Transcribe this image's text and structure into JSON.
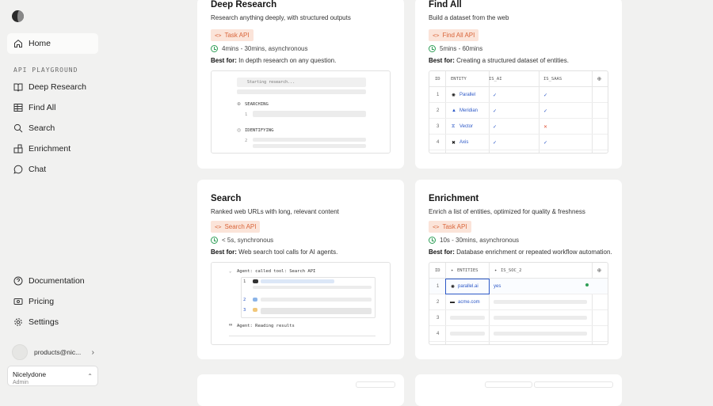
{
  "sidebar": {
    "home": "Home",
    "section_label": "API PLAYGROUND",
    "items": [
      {
        "label": "Deep Research",
        "icon": "book-icon"
      },
      {
        "label": "Find All",
        "icon": "table-icon"
      },
      {
        "label": "Search",
        "icon": "search-icon"
      },
      {
        "label": "Enrichment",
        "icon": "enrichment-icon"
      },
      {
        "label": "Chat",
        "icon": "chat-icon"
      }
    ],
    "bottom": [
      {
        "label": "Documentation",
        "icon": "help-icon"
      },
      {
        "label": "Pricing",
        "icon": "dollar-icon"
      },
      {
        "label": "Settings",
        "icon": "gear-icon"
      }
    ],
    "user_email": "products@nic...",
    "org_name": "Nicelydone",
    "org_role": "Admin"
  },
  "cards": {
    "deep_research": {
      "title": "Deep Research",
      "desc": "Research anything deeply, with structured outputs",
      "badge": "Task API",
      "timing": "4mins - 30mins, asynchronous",
      "best_label": "Best for:",
      "best_text": " In depth research on any question.",
      "preview": {
        "starting": "Starting research...",
        "searching": "SEARCHING",
        "identifying": "IDENTIFYING",
        "n1": "1",
        "n2": "2"
      }
    },
    "find_all": {
      "title": "Find All",
      "desc": "Build a dataset from the web",
      "badge": "Find All API",
      "timing": "5mins - 60mins",
      "best_label": "Best for:",
      "best_text": " Creating a structured dataset of entities.",
      "columns": [
        "ID",
        "ENTITY",
        "IS_AI",
        "IS_SAAS"
      ],
      "rows": [
        {
          "id": "1",
          "entity": "Parallel",
          "is_ai": "✓",
          "is_saas": "✓"
        },
        {
          "id": "2",
          "entity": "Meridian",
          "is_ai": "✓",
          "is_saas": "✓"
        },
        {
          "id": "3",
          "entity": "Vector",
          "is_ai": "✓",
          "is_saas": "✕"
        },
        {
          "id": "4",
          "entity": "Axis",
          "is_ai": "✓",
          "is_saas": "✓"
        }
      ]
    },
    "search": {
      "title": "Search",
      "desc": "Ranked web URLs with long, relevant content",
      "badge": "Search API",
      "timing": "< 5s, synchronous",
      "best_label": "Best for:",
      "best_text": " Web search tool calls for AI agents.",
      "preview": {
        "called": "Agent: called tool: Search API",
        "reading": "Agent: Reading results",
        "n1": "1",
        "n2": "2",
        "n3": "3"
      }
    },
    "enrichment": {
      "title": "Enrichment",
      "desc": "Enrich a list of entities, optimized for quality & freshness",
      "badge": "Task API",
      "timing": "10s - 30mins, asynchronous",
      "best_label": "Best for:",
      "best_text": " Database enrichment or repeated workflow automation.",
      "columns": [
        "ID",
        "ENTITIES",
        "IS_SOC_2"
      ],
      "rows": [
        {
          "id": "1",
          "entity": "parallel.ai",
          "value": "yes"
        },
        {
          "id": "2",
          "entity": "acme.com",
          "value": ""
        },
        {
          "id": "3",
          "entity": "",
          "value": ""
        },
        {
          "id": "4",
          "entity": "",
          "value": ""
        }
      ]
    }
  },
  "colors": {
    "accent_badge_bg": "#fbe4d9",
    "accent_badge_text": "#d9653a",
    "timing_green": "#2f9e57",
    "entity_blue": "#2c58c7"
  }
}
